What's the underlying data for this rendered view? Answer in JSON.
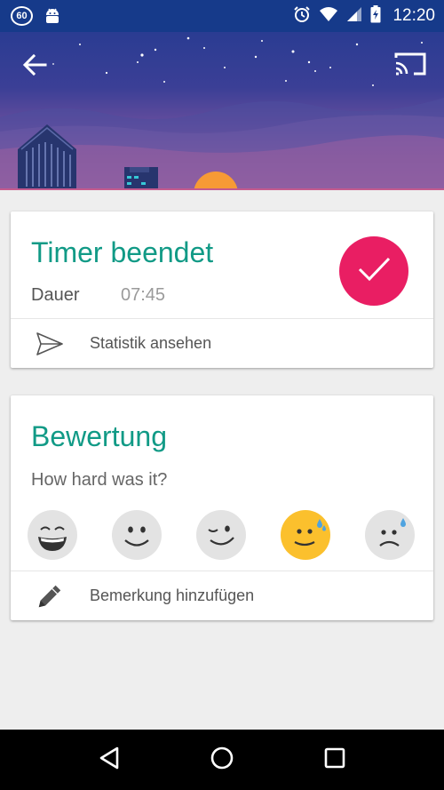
{
  "status_bar": {
    "notification_badge": "60",
    "time": "12:20",
    "icons": [
      "android-icon",
      "alarm-icon",
      "wifi-icon",
      "signal-icon",
      "battery-charging-icon"
    ]
  },
  "header": {
    "back_icon": "arrow-back-icon",
    "cast_icon": "cast-icon"
  },
  "timer_card": {
    "title": "Timer beendet",
    "duration_label": "Dauer",
    "duration_value": "07:45",
    "done_icon": "check-icon",
    "action_label": "Statistik ansehen",
    "action_icon": "send-icon"
  },
  "rating_card": {
    "title": "Bewertung",
    "question": "How hard was it?",
    "faces": [
      {
        "icon": "grinning-face-icon",
        "selected": false
      },
      {
        "icon": "smiling-face-icon",
        "selected": false
      },
      {
        "icon": "winking-face-icon",
        "selected": false
      },
      {
        "icon": "sweating-smile-face-icon",
        "selected": true
      },
      {
        "icon": "sad-sweat-face-icon",
        "selected": false
      }
    ],
    "action_label": "Bemerkung hinzufügen",
    "action_icon": "pencil-icon"
  },
  "colors": {
    "accent": "#119a86",
    "done": "#e91e63",
    "selected_face": "#fbc02d",
    "status_bar": "#163a8a"
  },
  "nav_bar": {
    "icons": [
      "nav-back-icon",
      "nav-home-icon",
      "nav-recents-icon"
    ]
  }
}
